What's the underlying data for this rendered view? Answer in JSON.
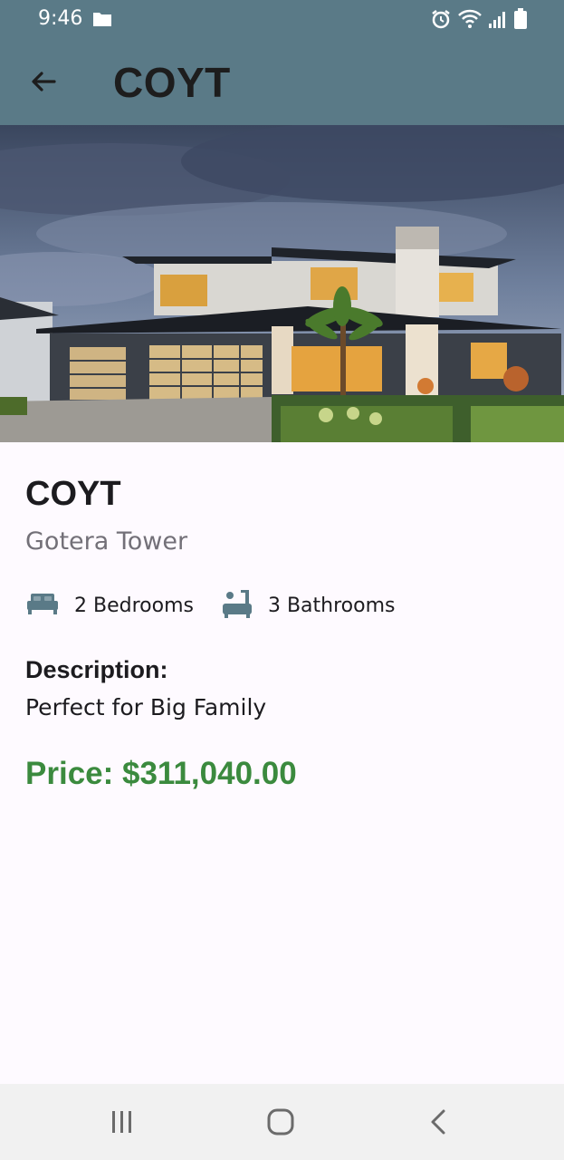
{
  "status_bar": {
    "time": "9:46"
  },
  "app_bar": {
    "title": "COYT"
  },
  "property": {
    "name": "COYT",
    "location": "Gotera Tower",
    "bedrooms_label": "2 Bedrooms",
    "bathrooms_label": "3 Bathrooms",
    "description_label": "Description:",
    "description": "Perfect for Big Family",
    "price_label": "Price: $311,040.00"
  },
  "colors": {
    "app_bar": "#5a7a87",
    "icon": "#5a7a87",
    "price": "#3b8a3e",
    "background": "#fefaff"
  }
}
